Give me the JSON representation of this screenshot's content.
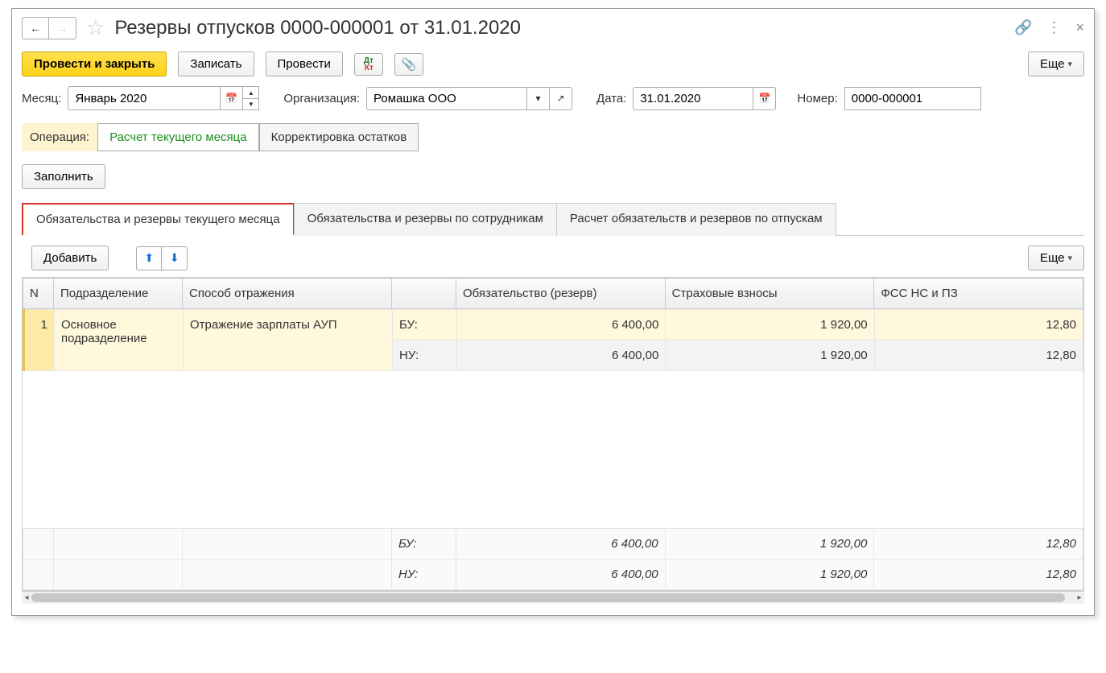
{
  "title": "Резервы отпусков 0000-000001 от 31.01.2020",
  "nav": {
    "back": "←",
    "forward": "→"
  },
  "toolbar": {
    "post_close": "Провести и закрыть",
    "save": "Записать",
    "post": "Провести",
    "more": "Еще"
  },
  "form": {
    "month_label": "Месяц:",
    "month_value": "Январь 2020",
    "org_label": "Организация:",
    "org_value": "Ромашка ООО",
    "date_label": "Дата:",
    "date_value": "31.01.2020",
    "number_label": "Номер:",
    "number_value": "0000-000001"
  },
  "operation": {
    "label": "Операция:",
    "current": "Расчет текущего месяца",
    "adj": "Корректировка остатков"
  },
  "fill_btn": "Заполнить",
  "tabs": {
    "t1": "Обязательства и резервы текущего месяца",
    "t2": "Обязательства и резервы по сотрудникам",
    "t3": "Расчет обязательств и резервов по отпускам"
  },
  "table_toolbar": {
    "add": "Добавить",
    "more": "Еще"
  },
  "columns": {
    "n": "N",
    "dep": "Подразделение",
    "way": "Способ отражения",
    "blank": "",
    "obl": "Обязательство (резерв)",
    "ins": "Страховые взносы",
    "fss": "ФСС НС и ПЗ"
  },
  "row": {
    "n": "1",
    "dep": "Основное подразделение",
    "way": "Отражение зарплаты АУП",
    "bu": "БУ:",
    "nu": "НУ:",
    "obl_bu": "6 400,00",
    "ins_bu": "1 920,00",
    "fss_bu": "12,80",
    "obl_nu": "6 400,00",
    "ins_nu": "1 920,00",
    "fss_nu": "12,80"
  },
  "totals": {
    "bu": "БУ:",
    "nu": "НУ:",
    "obl_bu": "6 400,00",
    "ins_bu": "1 920,00",
    "fss_bu": "12,80",
    "obl_nu": "6 400,00",
    "ins_nu": "1 920,00",
    "fss_nu": "12,80"
  }
}
